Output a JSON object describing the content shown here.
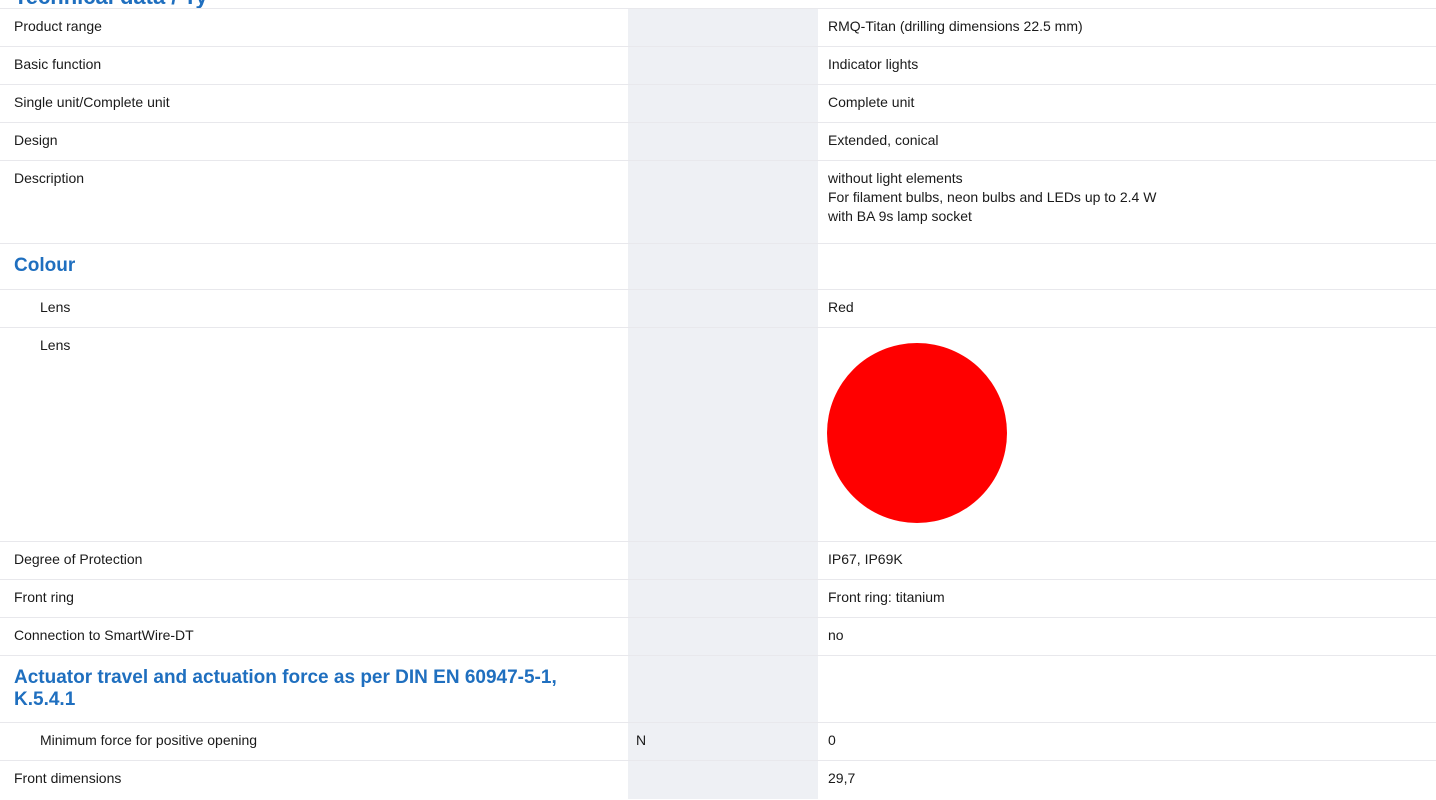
{
  "header": {
    "partial_title": "Technical data / Ty"
  },
  "rows": {
    "product_range": {
      "label": "Product range",
      "value": "RMQ-Titan (drilling dimensions 22.5 mm)"
    },
    "basic_function": {
      "label": "Basic function",
      "value": "Indicator lights"
    },
    "single_complete": {
      "label": "Single unit/Complete unit",
      "value": "Complete unit"
    },
    "design": {
      "label": "Design",
      "value": "Extended, conical"
    },
    "description": {
      "label": "Description",
      "value_lines": [
        "without light elements",
        "For filament bulbs, neon bulbs and LEDs up to 2.4 W",
        "with BA 9s lamp socket"
      ]
    },
    "colour_heading": {
      "label": "Colour"
    },
    "lens_text": {
      "label": "Lens",
      "value": "Red"
    },
    "lens_swatch": {
      "label": "Lens",
      "color": "#ff0000"
    },
    "degree_protection": {
      "label": "Degree of Protection",
      "value": "IP67, IP69K"
    },
    "front_ring": {
      "label": "Front ring",
      "value": "Front ring: titanium"
    },
    "smartwire": {
      "label": "Connection to SmartWire-DT",
      "value": "no"
    },
    "actuator_heading": {
      "label_lines": [
        "Actuator travel and actuation force as per DIN EN 60947-5-1,",
        "K.5.4.1"
      ]
    },
    "min_force": {
      "label": "Minimum force for positive opening",
      "unit": "N",
      "value": "0"
    },
    "front_dimensions": {
      "label": "Front dimensions",
      "value": "29,7"
    }
  }
}
